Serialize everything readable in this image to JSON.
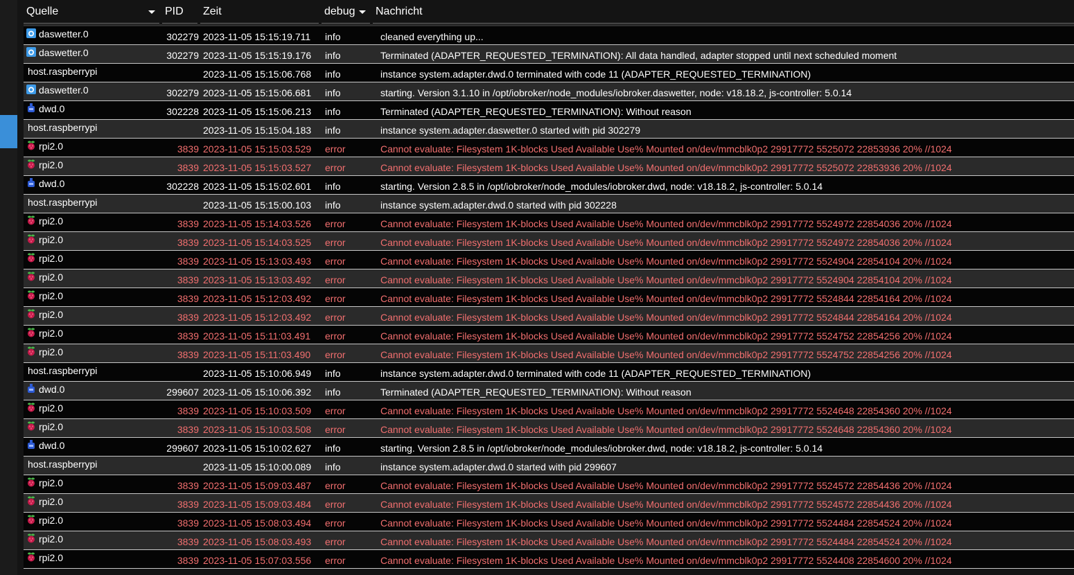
{
  "header": {
    "source": "Quelle",
    "pid": "PID",
    "time": "Zeit",
    "level": "debug",
    "message": "Nachricht"
  },
  "colors": {
    "error_text": "#f26f6f",
    "info_text": "#ffffff",
    "row_odd": "#050505",
    "row_even": "#2a2a2a",
    "accent": "#3a8fd9"
  },
  "rows": [
    {
      "source": "daswetter.0",
      "icon": "daswetter-icon",
      "pid": "302279",
      "time": "2023-11-05 15:15:19.711",
      "level": "info",
      "message": "cleaned everything up..."
    },
    {
      "source": "daswetter.0",
      "icon": "daswetter-icon",
      "pid": "302279",
      "time": "2023-11-05 15:15:19.176",
      "level": "info",
      "message": "Terminated (ADAPTER_REQUESTED_TERMINATION): All data handled, adapter stopped until next scheduled moment"
    },
    {
      "source": "host.raspberrypi",
      "icon": "",
      "pid": "",
      "time": "2023-11-05 15:15:06.768",
      "level": "info",
      "message": "instance system.adapter.dwd.0 terminated with code 11 (ADAPTER_REQUESTED_TERMINATION)"
    },
    {
      "source": "daswetter.0",
      "icon": "daswetter-icon",
      "pid": "302279",
      "time": "2023-11-05 15:15:06.681",
      "level": "info",
      "message": "starting. Version 3.1.10 in /opt/iobroker/node_modules/iobroker.daswetter, node: v18.18.2, js-controller: 5.0.14"
    },
    {
      "source": "dwd.0",
      "icon": "dwd-icon",
      "pid": "302228",
      "time": "2023-11-05 15:15:06.213",
      "level": "info",
      "message": "Terminated (ADAPTER_REQUESTED_TERMINATION): Without reason"
    },
    {
      "source": "host.raspberrypi",
      "icon": "",
      "pid": "",
      "time": "2023-11-05 15:15:04.183",
      "level": "info",
      "message": "instance system.adapter.daswetter.0 started with pid 302279"
    },
    {
      "source": "rpi2.0",
      "icon": "raspberry-icon",
      "pid": "3839",
      "time": "2023-11-05 15:15:03.529",
      "level": "error",
      "message": "Cannot evaluate: Filesystem 1K-blocks Used Available Use% Mounted on/dev/mmcblk0p2 29917772 5525072 22853936 20% //1024"
    },
    {
      "source": "rpi2.0",
      "icon": "raspberry-icon",
      "pid": "3839",
      "time": "2023-11-05 15:15:03.527",
      "level": "error",
      "message": "Cannot evaluate: Filesystem 1K-blocks Used Available Use% Mounted on/dev/mmcblk0p2 29917772 5525072 22853936 20% //1024"
    },
    {
      "source": "dwd.0",
      "icon": "dwd-icon",
      "pid": "302228",
      "time": "2023-11-05 15:15:02.601",
      "level": "info",
      "message": "starting. Version 2.8.5 in /opt/iobroker/node_modules/iobroker.dwd, node: v18.18.2, js-controller: 5.0.14"
    },
    {
      "source": "host.raspberrypi",
      "icon": "",
      "pid": "",
      "time": "2023-11-05 15:15:00.103",
      "level": "info",
      "message": "instance system.adapter.dwd.0 started with pid 302228"
    },
    {
      "source": "rpi2.0",
      "icon": "raspberry-icon",
      "pid": "3839",
      "time": "2023-11-05 15:14:03.526",
      "level": "error",
      "message": "Cannot evaluate: Filesystem 1K-blocks Used Available Use% Mounted on/dev/mmcblk0p2 29917772 5524972 22854036 20% //1024"
    },
    {
      "source": "rpi2.0",
      "icon": "raspberry-icon",
      "pid": "3839",
      "time": "2023-11-05 15:14:03.525",
      "level": "error",
      "message": "Cannot evaluate: Filesystem 1K-blocks Used Available Use% Mounted on/dev/mmcblk0p2 29917772 5524972 22854036 20% //1024"
    },
    {
      "source": "rpi2.0",
      "icon": "raspberry-icon",
      "pid": "3839",
      "time": "2023-11-05 15:13:03.493",
      "level": "error",
      "message": "Cannot evaluate: Filesystem 1K-blocks Used Available Use% Mounted on/dev/mmcblk0p2 29917772 5524904 22854104 20% //1024"
    },
    {
      "source": "rpi2.0",
      "icon": "raspberry-icon",
      "pid": "3839",
      "time": "2023-11-05 15:13:03.492",
      "level": "error",
      "message": "Cannot evaluate: Filesystem 1K-blocks Used Available Use% Mounted on/dev/mmcblk0p2 29917772 5524904 22854104 20% //1024"
    },
    {
      "source": "rpi2.0",
      "icon": "raspberry-icon",
      "pid": "3839",
      "time": "2023-11-05 15:12:03.492",
      "level": "error",
      "message": "Cannot evaluate: Filesystem 1K-blocks Used Available Use% Mounted on/dev/mmcblk0p2 29917772 5524844 22854164 20% //1024"
    },
    {
      "source": "rpi2.0",
      "icon": "raspberry-icon",
      "pid": "3839",
      "time": "2023-11-05 15:12:03.492",
      "level": "error",
      "message": "Cannot evaluate: Filesystem 1K-blocks Used Available Use% Mounted on/dev/mmcblk0p2 29917772 5524844 22854164 20% //1024"
    },
    {
      "source": "rpi2.0",
      "icon": "raspberry-icon",
      "pid": "3839",
      "time": "2023-11-05 15:11:03.491",
      "level": "error",
      "message": "Cannot evaluate: Filesystem 1K-blocks Used Available Use% Mounted on/dev/mmcblk0p2 29917772 5524752 22854256 20% //1024"
    },
    {
      "source": "rpi2.0",
      "icon": "raspberry-icon",
      "pid": "3839",
      "time": "2023-11-05 15:11:03.490",
      "level": "error",
      "message": "Cannot evaluate: Filesystem 1K-blocks Used Available Use% Mounted on/dev/mmcblk0p2 29917772 5524752 22854256 20% //1024"
    },
    {
      "source": "host.raspberrypi",
      "icon": "",
      "pid": "",
      "time": "2023-11-05 15:10:06.949",
      "level": "info",
      "message": "instance system.adapter.dwd.0 terminated with code 11 (ADAPTER_REQUESTED_TERMINATION)"
    },
    {
      "source": "dwd.0",
      "icon": "dwd-icon",
      "pid": "299607",
      "time": "2023-11-05 15:10:06.392",
      "level": "info",
      "message": "Terminated (ADAPTER_REQUESTED_TERMINATION): Without reason"
    },
    {
      "source": "rpi2.0",
      "icon": "raspberry-icon",
      "pid": "3839",
      "time": "2023-11-05 15:10:03.509",
      "level": "error",
      "message": "Cannot evaluate: Filesystem 1K-blocks Used Available Use% Mounted on/dev/mmcblk0p2 29917772 5524648 22854360 20% //1024"
    },
    {
      "source": "rpi2.0",
      "icon": "raspberry-icon",
      "pid": "3839",
      "time": "2023-11-05 15:10:03.508",
      "level": "error",
      "message": "Cannot evaluate: Filesystem 1K-blocks Used Available Use% Mounted on/dev/mmcblk0p2 29917772 5524648 22854360 20% //1024"
    },
    {
      "source": "dwd.0",
      "icon": "dwd-icon",
      "pid": "299607",
      "time": "2023-11-05 15:10:02.627",
      "level": "info",
      "message": "starting. Version 2.8.5 in /opt/iobroker/node_modules/iobroker.dwd, node: v18.18.2, js-controller: 5.0.14"
    },
    {
      "source": "host.raspberrypi",
      "icon": "",
      "pid": "",
      "time": "2023-11-05 15:10:00.089",
      "level": "info",
      "message": "instance system.adapter.dwd.0 started with pid 299607"
    },
    {
      "source": "rpi2.0",
      "icon": "raspberry-icon",
      "pid": "3839",
      "time": "2023-11-05 15:09:03.487",
      "level": "error",
      "message": "Cannot evaluate: Filesystem 1K-blocks Used Available Use% Mounted on/dev/mmcblk0p2 29917772 5524572 22854436 20% //1024"
    },
    {
      "source": "rpi2.0",
      "icon": "raspberry-icon",
      "pid": "3839",
      "time": "2023-11-05 15:09:03.484",
      "level": "error",
      "message": "Cannot evaluate: Filesystem 1K-blocks Used Available Use% Mounted on/dev/mmcblk0p2 29917772 5524572 22854436 20% //1024"
    },
    {
      "source": "rpi2.0",
      "icon": "raspberry-icon",
      "pid": "3839",
      "time": "2023-11-05 15:08:03.494",
      "level": "error",
      "message": "Cannot evaluate: Filesystem 1K-blocks Used Available Use% Mounted on/dev/mmcblk0p2 29917772 5524484 22854524 20% //1024"
    },
    {
      "source": "rpi2.0",
      "icon": "raspberry-icon",
      "pid": "3839",
      "time": "2023-11-05 15:08:03.493",
      "level": "error",
      "message": "Cannot evaluate: Filesystem 1K-blocks Used Available Use% Mounted on/dev/mmcblk0p2 29917772 5524484 22854524 20% //1024"
    },
    {
      "source": "rpi2.0",
      "icon": "raspberry-icon",
      "pid": "3839",
      "time": "2023-11-05 15:07:03.556",
      "level": "error",
      "message": "Cannot evaluate: Filesystem 1K-blocks Used Available Use% Mounted on/dev/mmcblk0p2 29917772 5524408 22854600 20% //1024"
    }
  ]
}
